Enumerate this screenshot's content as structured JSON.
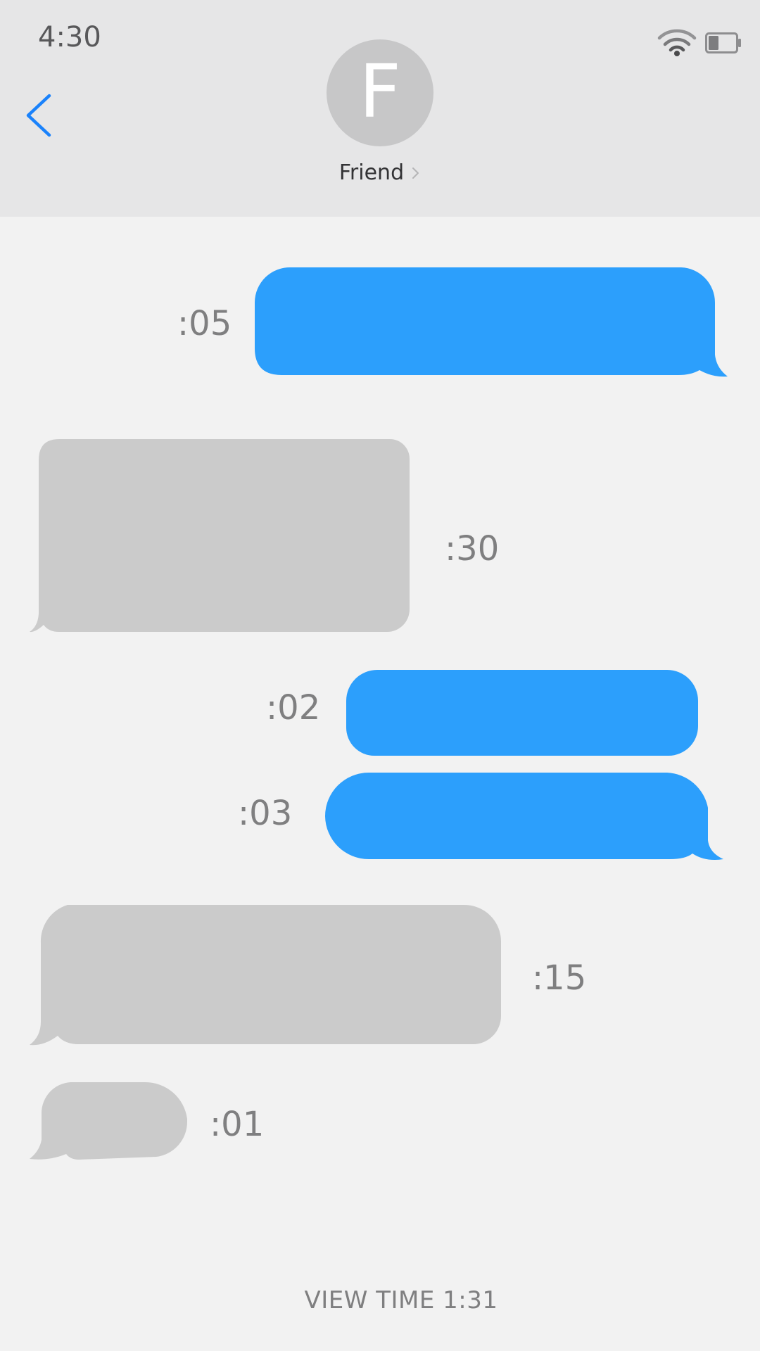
{
  "status_bar": {
    "time": "4:30",
    "wifi_icon": "wifi-icon",
    "battery_icon": "battery-low-icon"
  },
  "header": {
    "back_icon": "chevron-left-icon",
    "avatar_letter": "F",
    "contact_name": "Friend",
    "contact_chevron_icon": "chevron-right-icon"
  },
  "messages": [
    {
      "sender": "me",
      "time": ":05"
    },
    {
      "sender": "friend",
      "time": ":30"
    },
    {
      "sender": "me",
      "time": ":02"
    },
    {
      "sender": "me",
      "time": ":03"
    },
    {
      "sender": "friend",
      "time": ":15"
    },
    {
      "sender": "friend",
      "time": ":01"
    }
  ],
  "footer": {
    "view_time": "VIEW TIME 1:31"
  },
  "colors": {
    "header_bg": "#e6e6e7",
    "page_bg": "#f2f2f2",
    "sent_bubble": "#2c9ffc",
    "received_bubble": "#cbcbcb",
    "accent": "#1a82fb",
    "time_text": "#7f7f80"
  }
}
